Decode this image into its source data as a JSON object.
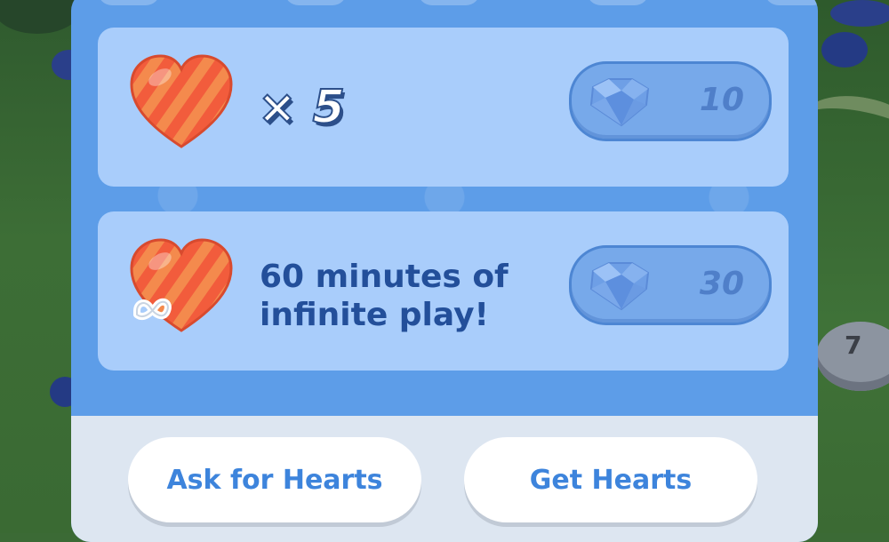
{
  "level_node": {
    "number": "7"
  },
  "offers": [
    {
      "type": "hearts",
      "multiplier_text": "× 5",
      "price": "10"
    },
    {
      "type": "infinite",
      "description": "60 minutes of infinite play!",
      "price": "30"
    }
  ],
  "buttons": {
    "ask_label": "Ask for Hearts",
    "get_label": "Get Hearts"
  },
  "colors": {
    "panel": "#5d9de8",
    "offer_bg": "#a9cdfb",
    "heart": "#f2603f",
    "button_text": "#3d84dc"
  },
  "icons": {
    "heart": "heart-icon",
    "gem": "gem-icon",
    "infinity": "infinity-icon"
  }
}
